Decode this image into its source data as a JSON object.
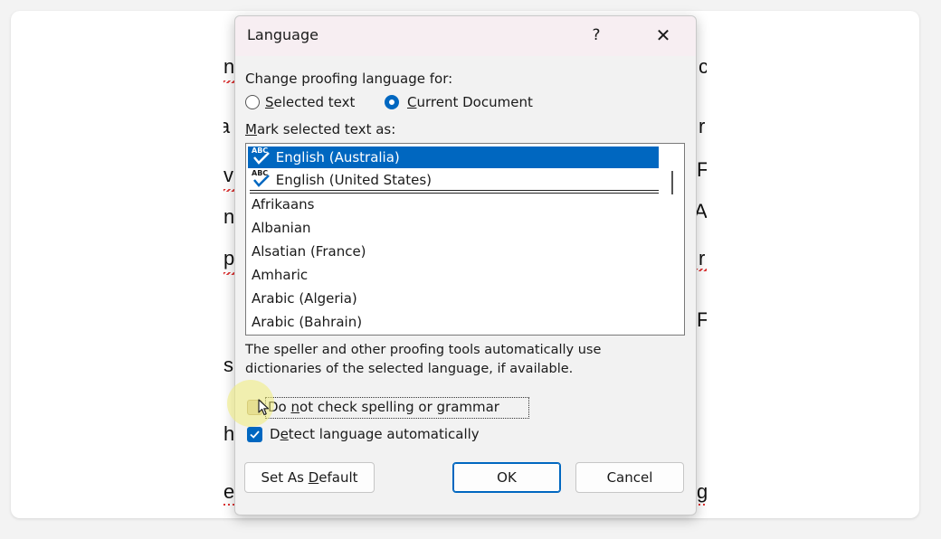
{
  "dialog": {
    "title": "Language",
    "help_label": "?",
    "close_label": "✕",
    "change_proofing_label": "Change proofing language for:",
    "radio_selected_text": {
      "access": "S",
      "rest": "elected text"
    },
    "radio_current_document": {
      "access": "C",
      "rest": "urrent Document"
    },
    "radio_checked": "current_document",
    "mark_selected_label": {
      "access": "M",
      "rest": "ark selected text as:"
    },
    "languages": [
      {
        "label": "English (Australia)",
        "icon": "spellcheck-icon",
        "selected": true
      },
      {
        "label": "English (United States)",
        "icon": "spellcheck-icon",
        "selected": false
      },
      {
        "label": "Afrikaans"
      },
      {
        "label": "Albanian"
      },
      {
        "label": "Alsatian (France)"
      },
      {
        "label": "Amharic"
      },
      {
        "label": "Arabic (Algeria)"
      },
      {
        "label": "Arabic (Bahrain)"
      }
    ],
    "abc_icon_text": "ABC",
    "info_line1": "The speller and other proofing tools automatically use",
    "info_line2": "dictionaries of the selected language, if available.",
    "no_check": {
      "pre": "Do ",
      "access": "n",
      "rest": "ot check spelling or grammar",
      "checked": false
    },
    "detect": {
      "pre": "D",
      "access": "e",
      "rest": "tect language automatically",
      "checked": true
    },
    "set_default": {
      "pre": "Set As ",
      "access": "D",
      "rest": "efault"
    },
    "ok_label": "OK",
    "cancel_label": "Cancel"
  },
  "background_doc": {
    "left_glyphs": [
      "n",
      "la",
      "v",
      "n",
      "p",
      "s",
      "h",
      "e"
    ],
    "right_glyphs": [
      "c",
      "r",
      "F",
      "A",
      "r",
      "F",
      "g"
    ]
  },
  "colors": {
    "accent": "#0067c0",
    "highlight": "#f0ec78"
  }
}
